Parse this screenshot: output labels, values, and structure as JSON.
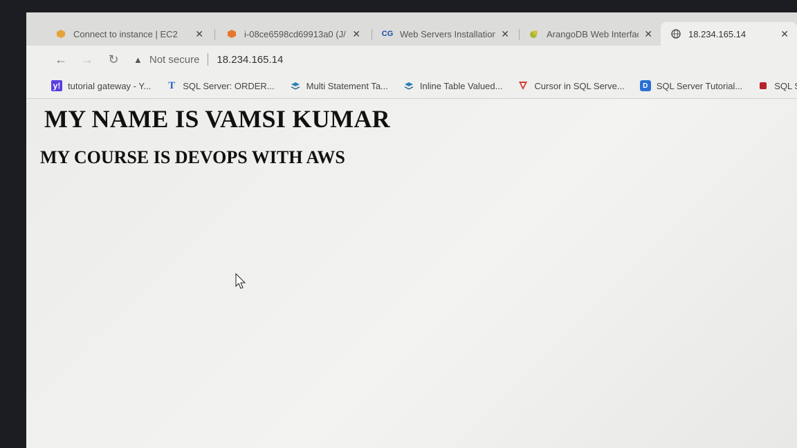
{
  "tabs": [
    {
      "label": "Connect to instance | EC2",
      "icon": "aws-box-icon",
      "color": "#e8a23a"
    },
    {
      "label": "i-08ce6598cd69913a0 (J/",
      "icon": "ec2-box-icon",
      "color": "#e8762c"
    },
    {
      "label": "Web Servers Installation",
      "icon": "cg-logo-icon",
      "color": "#1a4fa8"
    },
    {
      "label": "ArangoDB Web Interface",
      "icon": "arangodb-icon",
      "color": "#a8b832"
    },
    {
      "label": "18.234.165.14",
      "icon": "globe-icon",
      "color": "#555555"
    }
  ],
  "address_bar": {
    "security_label": "Not secure",
    "url": "18.234.165.14"
  },
  "bookmarks": [
    {
      "label": "tutorial gateway - Y...",
      "icon": "yahoo-icon",
      "color": "#5b3ee0"
    },
    {
      "label": "SQL Server: ORDER...",
      "icon": "t-logo-icon",
      "color": "#2b64c8"
    },
    {
      "label": "Multi Statement Ta...",
      "icon": "stack-icon",
      "color": "#2a7fb8"
    },
    {
      "label": "Inline Table Valued...",
      "icon": "stack-icon",
      "color": "#2a7fb8"
    },
    {
      "label": "Cursor in SQL Serve...",
      "icon": "v-shield-icon",
      "color": "#d63a2a"
    },
    {
      "label": "SQL Server Tutorial...",
      "icon": "d-logo-icon",
      "color": "#2a6fd6"
    },
    {
      "label": "SQL Server M",
      "icon": "red-square-icon",
      "color": "#b8202a"
    }
  ],
  "page": {
    "heading": "MY NAME IS VAMSI KUMAR",
    "subheading": "MY COURSE IS DEVOPS WITH AWS"
  }
}
